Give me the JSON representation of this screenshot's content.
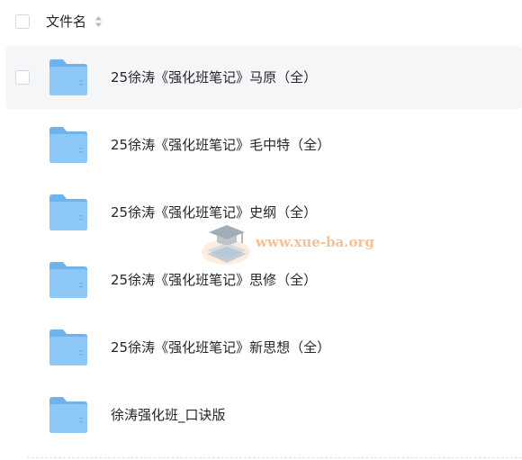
{
  "header": {
    "column_label": "文件名"
  },
  "files": [
    {
      "name": "25徐涛《强化班笔记》马原（全）",
      "type": "folder",
      "selected": true
    },
    {
      "name": "25徐涛《强化班笔记》毛中特（全）",
      "type": "folder",
      "selected": false
    },
    {
      "name": "25徐涛《强化班笔记》史纲（全）",
      "type": "folder",
      "selected": false
    },
    {
      "name": "25徐涛《强化班笔记》思修（全）",
      "type": "folder",
      "selected": false
    },
    {
      "name": "25徐涛《强化班笔记》新思想（全）",
      "type": "folder",
      "selected": false
    },
    {
      "name": "徐涛强化班_口诀版",
      "type": "folder",
      "selected": false
    }
  ],
  "watermark": {
    "text": "www.xue-ba.org",
    "icon": "graduation-cap-books-logo"
  },
  "colors": {
    "folder_body": "#8ec8f6",
    "folder_tab": "#6fb3ee",
    "row_hover": "#f5f6f8",
    "watermark": "#f0c29a"
  }
}
